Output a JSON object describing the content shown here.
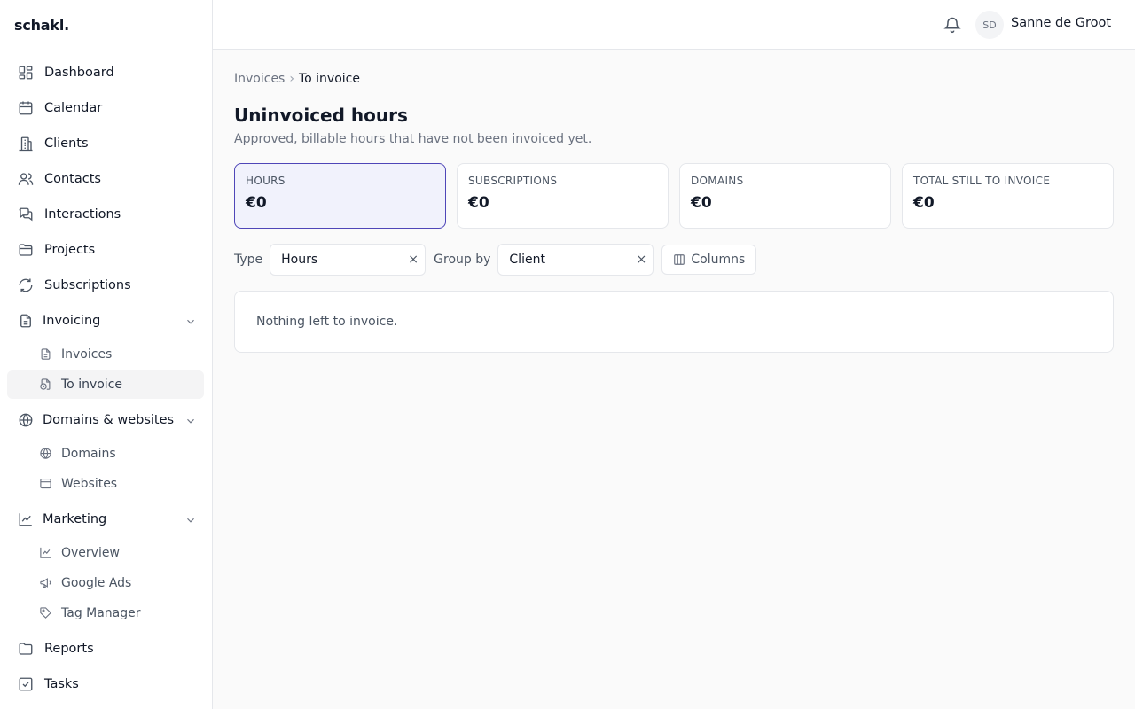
{
  "app": {
    "logo": "schakl."
  },
  "sidebar": {
    "items": [
      {
        "label": "Dashboard",
        "icon": "dashboard-icon"
      },
      {
        "label": "Calendar",
        "icon": "calendar-icon"
      },
      {
        "label": "Clients",
        "icon": "building-icon"
      },
      {
        "label": "Contacts",
        "icon": "users-icon"
      },
      {
        "label": "Interactions",
        "icon": "chat-icon"
      },
      {
        "label": "Projects",
        "icon": "folder-icon"
      },
      {
        "label": "Subscriptions",
        "icon": "refresh-icon"
      }
    ],
    "invoicing": {
      "label": "Invoicing",
      "icon": "document-icon",
      "children": [
        {
          "label": "Invoices",
          "icon": "file-icon"
        },
        {
          "label": "To invoice",
          "icon": "file-clock-icon",
          "active": true
        }
      ]
    },
    "domains": {
      "label": "Domains & websites",
      "icon": "globe-icon",
      "children": [
        {
          "label": "Domains",
          "icon": "globe-icon"
        },
        {
          "label": "Websites",
          "icon": "browser-icon"
        }
      ]
    },
    "marketing": {
      "label": "Marketing",
      "icon": "chart-line-icon",
      "children": [
        {
          "label": "Overview",
          "icon": "chart-line-icon"
        },
        {
          "label": "Google Ads",
          "icon": "megaphone-icon"
        },
        {
          "label": "Tag Manager",
          "icon": "tag-icon"
        }
      ]
    },
    "bottom": [
      {
        "label": "Reports",
        "icon": "report-icon"
      },
      {
        "label": "Tasks",
        "icon": "checkbox-icon"
      }
    ]
  },
  "header": {
    "avatar_initials": "SD",
    "user_name": "Sanne de Groot"
  },
  "breadcrumb": {
    "parent": "Invoices",
    "separator": "›",
    "current": "To invoice"
  },
  "page": {
    "title": "Uninvoiced hours",
    "subtitle": "Approved, billable hours that have not been invoiced yet."
  },
  "summary_cards": [
    {
      "label": "Hours",
      "value": "€0",
      "active": true
    },
    {
      "label": "Subscriptions",
      "value": "€0"
    },
    {
      "label": "Domains",
      "value": "€0"
    },
    {
      "label": "Total still to invoice",
      "value": "€0"
    }
  ],
  "filters": {
    "type_label": "Type",
    "type_value": "Hours",
    "group_label": "Group by",
    "group_value": "Client",
    "columns_label": "Columns",
    "clear_glyph": "×"
  },
  "empty_state": {
    "message": "Nothing left to invoice."
  },
  "colors": {
    "accent": "#4f46b8",
    "active_card_bg": "#f1f2fc"
  }
}
